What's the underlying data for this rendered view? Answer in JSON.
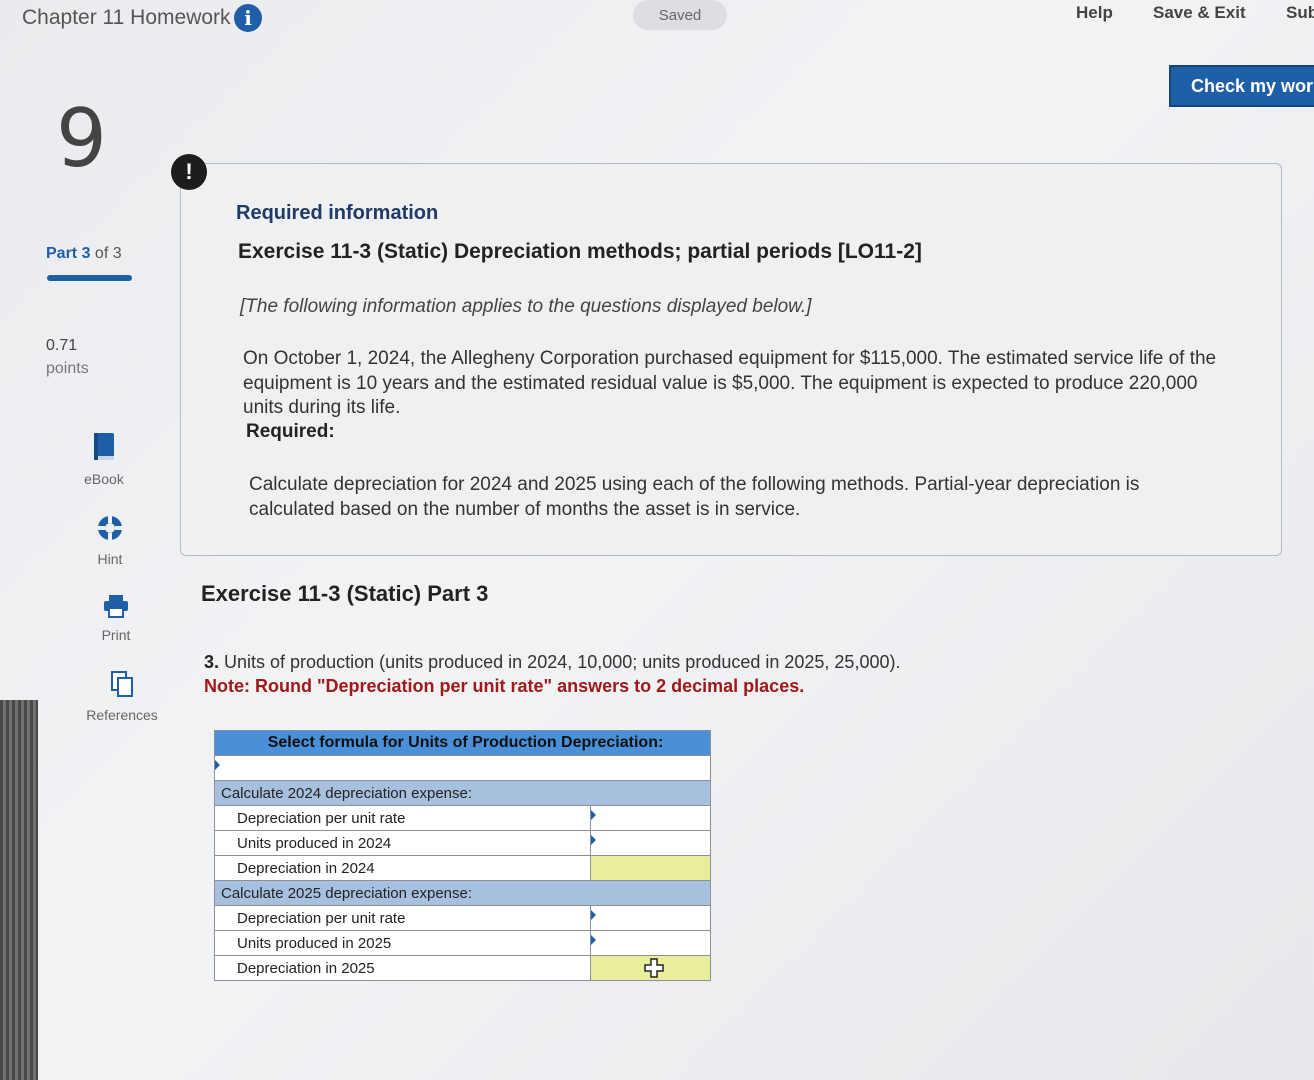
{
  "header": {
    "title": "Chapter 11 Homework",
    "saved": "Saved",
    "help": "Help",
    "save_exit": "Save & Exit",
    "submit": "Sub",
    "check_button": "Check my wor"
  },
  "sidebar": {
    "question_number": "9",
    "part_strong": "Part 3",
    "part_rest": " of 3",
    "points_value": "0.71",
    "points_label": "points",
    "tools": [
      {
        "label": "eBook",
        "icon": "book-icon"
      },
      {
        "label": "Hint",
        "icon": "hint-icon"
      },
      {
        "label": "Print",
        "icon": "print-icon"
      },
      {
        "label": "References",
        "icon": "references-icon"
      }
    ]
  },
  "info": {
    "alert": "!",
    "required_title": "Required information",
    "exercise_title": "Exercise 11-3 (Static) Depreciation methods; partial periods [LO11-2]",
    "applies_note": "[The following information applies to the questions displayed below.]",
    "paragraph": "On October 1, 2024, the Allegheny Corporation purchased equipment for $115,000. The estimated service life of the equipment is 10 years and the estimated residual value is $5,000. The equipment is expected to produce 220,000 units during its life.",
    "required_label": "Required:",
    "instructions": "Calculate depreciation for 2024 and 2025 using each of the following methods. Partial-year depreciation is calculated based on the number of months the asset is in service."
  },
  "part": {
    "title": "Exercise 11-3 (Static) Part 3",
    "question_num": "3.",
    "question_text": " Units of production (units produced in 2024, 10,000; units produced in 2025, 25,000).",
    "note": "Note: Round \"Depreciation per unit rate\" answers to 2 decimal places."
  },
  "worksheet": {
    "header": "Select formula for Units of Production Depreciation:",
    "formula_value": "",
    "section_2024": "Calculate 2024 depreciation expense:",
    "rows_2024": [
      {
        "label": "Depreciation per unit rate",
        "value": ""
      },
      {
        "label": "Units produced in 2024",
        "value": ""
      },
      {
        "label": "Depreciation in 2024",
        "value": ""
      }
    ],
    "section_2025": "Calculate 2025 depreciation expense:",
    "rows_2025": [
      {
        "label": "Depreciation per unit rate",
        "value": ""
      },
      {
        "label": "Units produced in 2025",
        "value": ""
      },
      {
        "label": "Depreciation in 2025",
        "value": ""
      }
    ]
  }
}
